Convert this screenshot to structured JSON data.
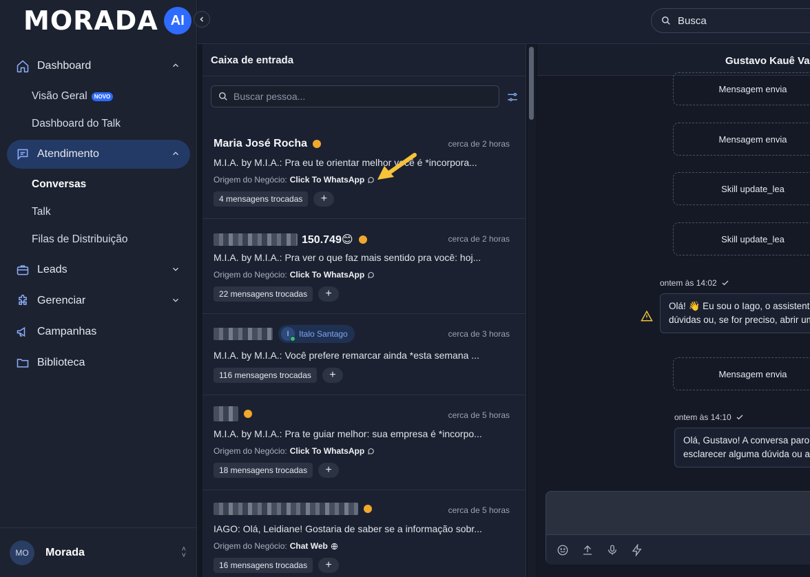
{
  "brand": {
    "logo_text": "MORADA",
    "logo_badge": "AI"
  },
  "sidebar": {
    "nav": [
      {
        "label": "Dashboard",
        "icon": "home-icon",
        "expanded": true,
        "children": [
          {
            "label": "Visão Geral",
            "badge": "NOVO"
          },
          {
            "label": "Dashboard do Talk"
          }
        ]
      },
      {
        "label": "Atendimento",
        "icon": "chat-icon",
        "expanded": true,
        "active": true,
        "children": [
          {
            "label": "Conversas",
            "active": true
          },
          {
            "label": "Talk"
          },
          {
            "label": "Filas de Distribuição"
          }
        ]
      },
      {
        "label": "Leads",
        "icon": "briefcase-icon",
        "expanded": false
      },
      {
        "label": "Gerenciar",
        "icon": "puzzle-icon",
        "expanded": false
      },
      {
        "label": "Campanhas",
        "icon": "megaphone-icon"
      },
      {
        "label": "Biblioteca",
        "icon": "folder-icon"
      }
    ],
    "user": {
      "initials": "MO",
      "name": "Morada"
    }
  },
  "topbar": {
    "search_value": "Busca"
  },
  "inbox": {
    "title": "Caixa de entrada",
    "search_placeholder": "Buscar pessoa...",
    "conversations": [
      {
        "name": "Maria José Rocha",
        "time": "cerca de 2 horas",
        "message": "M.I.A. by M.I.A.: Pra eu te orientar melhor você é *incorpora...",
        "origin_label": "Origem do Negócio:",
        "origin": "Click To WhatsApp",
        "messages": "4 mensagens trocadas"
      },
      {
        "name": "150.749😊",
        "time": "cerca de 2 horas",
        "message": "M.I.A. by M.I.A.: Pra ver o que faz mais sentido pra você: hoj...",
        "origin_label": "Origem do Negócio:",
        "origin": "Click To WhatsApp",
        "messages": "22 mensagens trocadas"
      },
      {
        "name": "",
        "agent": "Italo Santago",
        "agent_initial": "I",
        "time": "cerca de 3 horas",
        "message": "M.I.A. by M.I.A.: Você prefere remarcar ainda *esta semana ...",
        "messages": "116 mensagens trocadas"
      },
      {
        "name": "",
        "time": "cerca de 5 horas",
        "message": "M.I.A. by M.I.A.: Pra te guiar melhor: sua empresa é *incorpo...",
        "origin_label": "Origem do Negócio:",
        "origin": "Click To WhatsApp",
        "messages": "18 mensagens trocadas"
      },
      {
        "name": "",
        "time": "cerca de 5 horas",
        "message": "IAGO: Olá, Leidiane! Gostaria de saber se a informação sobr...",
        "origin_label": "Origem do Negócio:",
        "origin": "Chat Web",
        "messages": "16 mensagens trocadas"
      }
    ]
  },
  "chat": {
    "title": "Gustavo Kauê Va",
    "system_1": "Mensagem envia",
    "system_2": "Mensagem envia",
    "system_3": "Skill update_lea",
    "system_4": "Skill update_lea",
    "meta_1": "ontem às 14:02",
    "bubble_1_line1": "Olá! 👋 Eu sou o Iago, o assistente",
    "bubble_1_line2": "dúvidas ou, se for preciso, abrir um",
    "system_5": "Mensagem envia",
    "meta_2": "ontem às 14:10",
    "bubble_2_line1": "Olá, Gustavo! A conversa paro",
    "bubble_2_line2": "esclarecer alguma dúvida ou al"
  },
  "colors": {
    "accent": "#2f6bff",
    "status_dot": "#f0a92c",
    "active_nav": "#243a66",
    "annotation_arrow": "#f5c23a"
  }
}
